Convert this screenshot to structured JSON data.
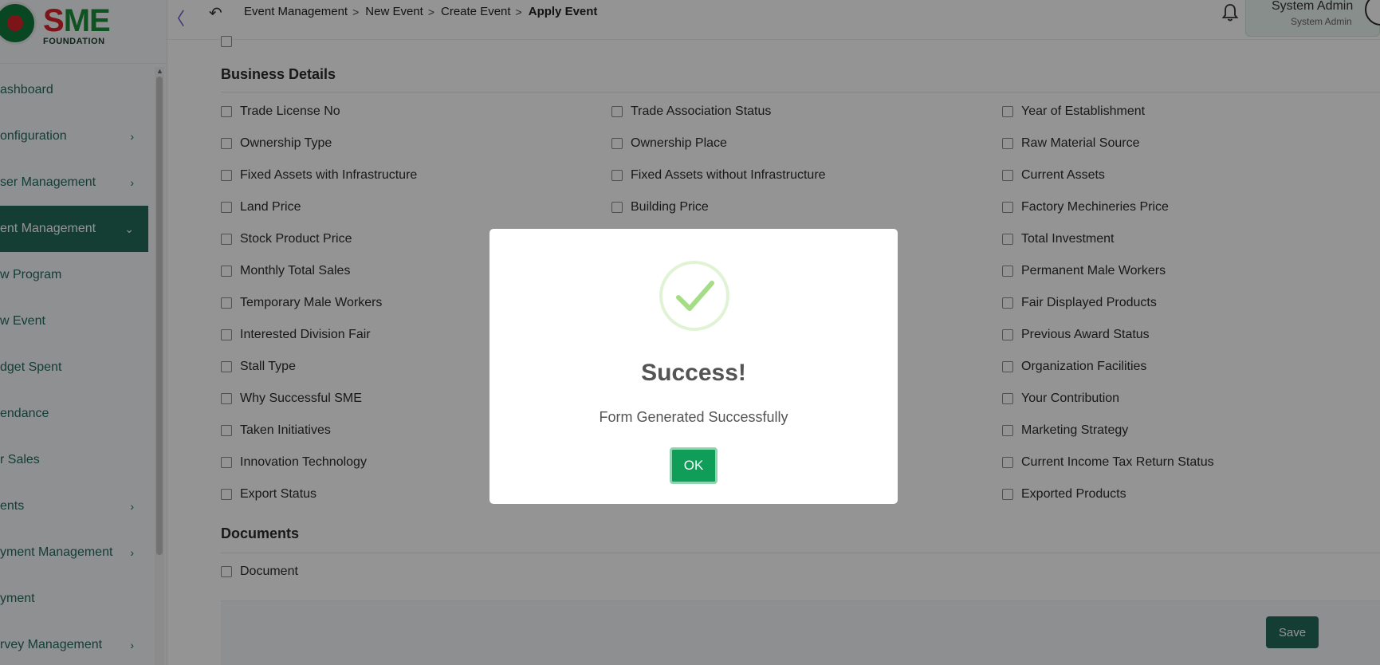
{
  "sidebar": {
    "logo": {
      "text_s": "S",
      "text_me": "ME",
      "subtitle": "FOUNDATION"
    },
    "items": [
      {
        "label": "ashboard",
        "has_chevron": false
      },
      {
        "label": "onfiguration",
        "has_chevron": true
      },
      {
        "label": "ser Management",
        "has_chevron": true
      },
      {
        "label": "ent Management",
        "has_chevron": true,
        "active": true
      },
      {
        "label": "w Program",
        "has_chevron": false
      },
      {
        "label": "w Event",
        "has_chevron": false
      },
      {
        "label": "dget Spent",
        "has_chevron": false
      },
      {
        "label": "endance",
        "has_chevron": false
      },
      {
        "label": "r Sales",
        "has_chevron": false
      },
      {
        "label": "ents",
        "has_chevron": true
      },
      {
        "label": "yment Management",
        "has_chevron": true
      },
      {
        "label": "yment",
        "has_chevron": false
      },
      {
        "label": "rvey Management",
        "has_chevron": true
      }
    ]
  },
  "header": {
    "breadcrumb": [
      "Event Management",
      "New Event",
      "Create Event"
    ],
    "breadcrumb_current": "Apply Event",
    "user_name": "System Admin",
    "user_role": "System Admin"
  },
  "business_details": {
    "title": "Business Details",
    "col1": [
      "Trade License No",
      "Ownership Type",
      "Fixed Assets with Infrastructure",
      "Land Price",
      "Stock Product Price",
      "Monthly Total Sales",
      "Temporary Male Workers",
      "Interested Division Fair",
      "Stall Type",
      "Why Successful SME",
      "Taken Initiatives",
      "Innovation Technology",
      "Export Status"
    ],
    "col2": [
      "Trade Association Status",
      "Ownership Place",
      "Fixed Assets without Infrastructure",
      "Building Price"
    ],
    "col3": [
      "Year of Establishment",
      "Raw Material Source",
      "Current Assets",
      "Factory Mechineries Price",
      "Total Investment",
      "Permanent Male Workers",
      "Fair Displayed Products",
      "Previous Award Status",
      "Organization Facilities",
      "Your Contribution",
      "Marketing Strategy",
      "Current Income Tax Return Status",
      "Exported Products"
    ]
  },
  "documents": {
    "title": "Documents",
    "items": [
      "Document"
    ]
  },
  "actions": {
    "save_label": "Save"
  },
  "modal": {
    "title": "Success!",
    "message": "Form Generated Successfully",
    "ok_label": "OK"
  },
  "colors": {
    "primary": "#236a5a",
    "ok_button": "#0f9d58",
    "success_check": "#a5dc86"
  },
  "icons": {
    "collapse": "chevron-left-icon",
    "back": "undo-icon",
    "notifications": "bell-icon",
    "success": "check-icon"
  }
}
